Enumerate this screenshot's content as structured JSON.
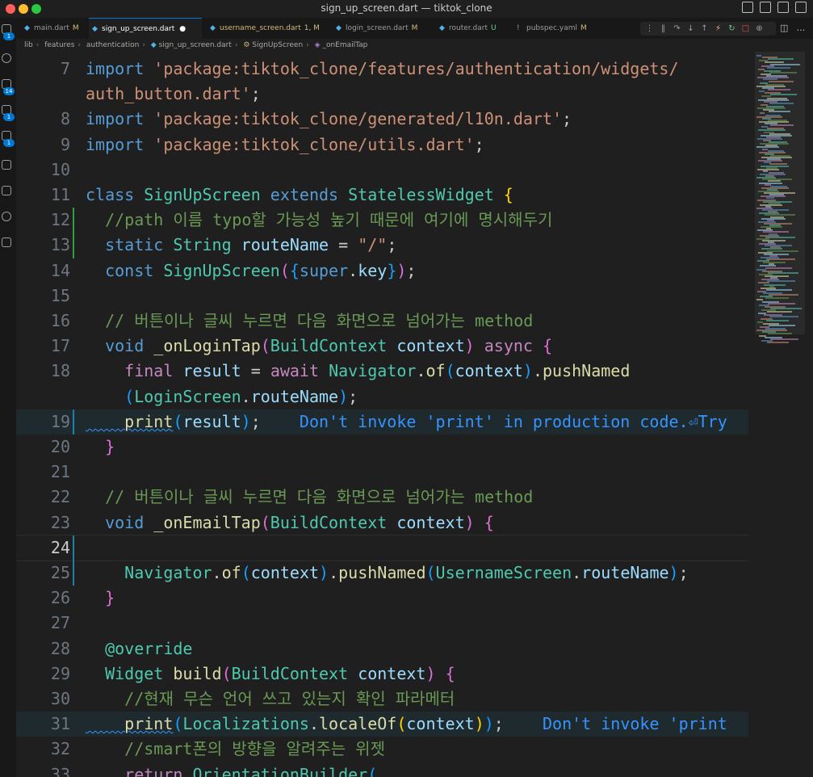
{
  "window": {
    "title": "sign_up_screen.dart — tiktok_clone",
    "traffic_lights": [
      "#ff5f57",
      "#febc2e",
      "#28c840"
    ]
  },
  "activity_bar": {
    "badges": [
      "1",
      "14",
      "1",
      "1"
    ]
  },
  "tabs": [
    {
      "name": "main.dart",
      "status": "M",
      "active": false,
      "warn": false
    },
    {
      "name": "sign_up_screen.dart",
      "status": "●",
      "active": true,
      "warn": false
    },
    {
      "name": "username_screen.dart",
      "status": "1, M",
      "active": false,
      "warn": true
    },
    {
      "name": "login_screen.dart",
      "status": "M",
      "active": false,
      "warn": false
    },
    {
      "name": "router.dart",
      "status": "U",
      "active": false,
      "warn": false
    },
    {
      "name": "pubspec.yaml",
      "status": "M",
      "active": false,
      "warn": false
    }
  ],
  "breadcrumbs": [
    "lib",
    "features",
    "authentication",
    "sign_up_screen.dart",
    "SignUpScreen",
    "_onEmailTap"
  ],
  "editor": {
    "current_line": "24",
    "lines": [
      {
        "n": "7",
        "segs": [
          [
            "k",
            "import "
          ],
          [
            "s",
            "'package:tiktok_clone/features/authentication/widgets/"
          ]
        ]
      },
      {
        "n": "",
        "segs": [
          [
            "s",
            "auth_button.dart'"
          ],
          [
            "p",
            ";"
          ]
        ]
      },
      {
        "n": "8",
        "segs": [
          [
            "k",
            "import "
          ],
          [
            "s",
            "'package:tiktok_clone/generated/l10n.dart'"
          ],
          [
            "p",
            ";"
          ]
        ]
      },
      {
        "n": "9",
        "segs": [
          [
            "k",
            "import "
          ],
          [
            "s",
            "'package:tiktok_clone/utils.dart'"
          ],
          [
            "p",
            ";"
          ]
        ]
      },
      {
        "n": "10",
        "segs": []
      },
      {
        "n": "11",
        "segs": [
          [
            "k",
            "class "
          ],
          [
            "t",
            "SignUpScreen "
          ],
          [
            "k",
            "extends "
          ],
          [
            "t",
            "StatelessWidget "
          ],
          [
            "b1",
            "{"
          ]
        ]
      },
      {
        "n": "12",
        "segs": [
          [
            "cm",
            "  //path 이름 typo할 가능성 높기 때문에 여기에 명시해두기"
          ]
        ]
      },
      {
        "n": "13",
        "segs": [
          [
            "k",
            "  static "
          ],
          [
            "t",
            "String "
          ],
          [
            "v",
            "routeName "
          ],
          [
            "p",
            "= "
          ],
          [
            "s",
            "\"/\""
          ],
          [
            "p",
            ";"
          ]
        ]
      },
      {
        "n": "14",
        "segs": [
          [
            "k",
            "  const "
          ],
          [
            "t",
            "SignUpScreen"
          ],
          [
            "b2",
            "("
          ],
          [
            "b3",
            "{"
          ],
          [
            "k",
            "super"
          ],
          [
            "p",
            "."
          ],
          [
            "v",
            "key"
          ],
          [
            "b3",
            "}"
          ],
          [
            "b2",
            ")"
          ],
          [
            "p",
            ";"
          ]
        ]
      },
      {
        "n": "15",
        "segs": []
      },
      {
        "n": "16",
        "segs": [
          [
            "cm",
            "  // 버튼이나 글씨 누르면 다음 화면으로 넘어가는 method"
          ]
        ]
      },
      {
        "n": "17",
        "segs": [
          [
            "k",
            "  void "
          ],
          [
            "f",
            "_onLoginTap"
          ],
          [
            "b2",
            "("
          ],
          [
            "t",
            "BuildContext "
          ],
          [
            "v",
            "context"
          ],
          [
            "b2",
            ") "
          ],
          [
            "c",
            "async "
          ],
          [
            "b2",
            "{"
          ]
        ]
      },
      {
        "n": "18",
        "segs": [
          [
            "c",
            "    final "
          ],
          [
            "v",
            "result "
          ],
          [
            "p",
            "= "
          ],
          [
            "c",
            "await "
          ],
          [
            "t",
            "Navigator"
          ],
          [
            "p",
            "."
          ],
          [
            "f",
            "of"
          ],
          [
            "b3",
            "("
          ],
          [
            "v",
            "context"
          ],
          [
            "b3",
            ")"
          ],
          [
            "p",
            "."
          ],
          [
            "f",
            "pushNamed"
          ]
        ]
      },
      {
        "n": "",
        "segs": [
          [
            "b3",
            "    ("
          ],
          [
            "t",
            "LoginScreen"
          ],
          [
            "p",
            "."
          ],
          [
            "v",
            "routeName"
          ],
          [
            "b3",
            ")"
          ],
          [
            "p",
            ";"
          ]
        ]
      },
      {
        "n": "19",
        "segs": [
          [
            "f",
            "    print"
          ],
          [
            "b3",
            "("
          ],
          [
            "v",
            "result"
          ],
          [
            "b3",
            ")"
          ],
          [
            "p",
            ";"
          ],
          [
            "lint",
            "    Don't invoke 'print' in production code.⏎Try"
          ]
        ],
        "hl": true
      },
      {
        "n": "20",
        "segs": [
          [
            "b2",
            "  }"
          ]
        ]
      },
      {
        "n": "21",
        "segs": []
      },
      {
        "n": "22",
        "segs": [
          [
            "cm",
            "  // 버튼이나 글씨 누르면 다음 화면으로 넘어가는 method"
          ]
        ]
      },
      {
        "n": "23",
        "segs": [
          [
            "k",
            "  void "
          ],
          [
            "f",
            "_onEmailTap"
          ],
          [
            "b2",
            "("
          ],
          [
            "t",
            "BuildContext "
          ],
          [
            "v",
            "context"
          ],
          [
            "b2",
            ") "
          ],
          [
            "b2",
            "{"
          ]
        ]
      },
      {
        "n": "24",
        "segs": [],
        "cur": true
      },
      {
        "n": "25",
        "segs": [
          [
            "t",
            "    Navigator"
          ],
          [
            "p",
            "."
          ],
          [
            "f",
            "of"
          ],
          [
            "b3",
            "("
          ],
          [
            "v",
            "context"
          ],
          [
            "b3",
            ")"
          ],
          [
            "p",
            "."
          ],
          [
            "f",
            "pushNamed"
          ],
          [
            "b3",
            "("
          ],
          [
            "t",
            "UsernameScreen"
          ],
          [
            "p",
            "."
          ],
          [
            "v",
            "routeName"
          ],
          [
            "b3",
            ")"
          ],
          [
            "p",
            ";"
          ]
        ]
      },
      {
        "n": "26",
        "segs": [
          [
            "b2",
            "  }"
          ]
        ]
      },
      {
        "n": "27",
        "segs": []
      },
      {
        "n": "28",
        "segs": [
          [
            "t",
            "  @override"
          ]
        ]
      },
      {
        "n": "29",
        "segs": [
          [
            "t",
            "  Widget "
          ],
          [
            "f",
            "build"
          ],
          [
            "b2",
            "("
          ],
          [
            "t",
            "BuildContext "
          ],
          [
            "v",
            "context"
          ],
          [
            "b2",
            ") "
          ],
          [
            "b2",
            "{"
          ]
        ]
      },
      {
        "n": "30",
        "segs": [
          [
            "cm",
            "    //현재 무슨 언어 쓰고 있는지 확인 파라메터"
          ]
        ]
      },
      {
        "n": "31",
        "segs": [
          [
            "f",
            "    print"
          ],
          [
            "b3",
            "("
          ],
          [
            "t",
            "Localizations"
          ],
          [
            "p",
            "."
          ],
          [
            "f",
            "localeOf"
          ],
          [
            "b1",
            "("
          ],
          [
            "v",
            "context"
          ],
          [
            "b1",
            ")"
          ],
          [
            "b3",
            ")"
          ],
          [
            "p",
            ";"
          ],
          [
            "lint",
            "    Don't invoke 'print"
          ]
        ],
        "hl": true
      },
      {
        "n": "32",
        "segs": [
          [
            "cm",
            "    //smart폰의 방향을 알려주는 위젯"
          ]
        ]
      },
      {
        "n": "33",
        "segs": [
          [
            "c",
            "    return "
          ],
          [
            "t",
            "OrientationBuilder"
          ],
          [
            "b3",
            "("
          ]
        ]
      }
    ]
  }
}
